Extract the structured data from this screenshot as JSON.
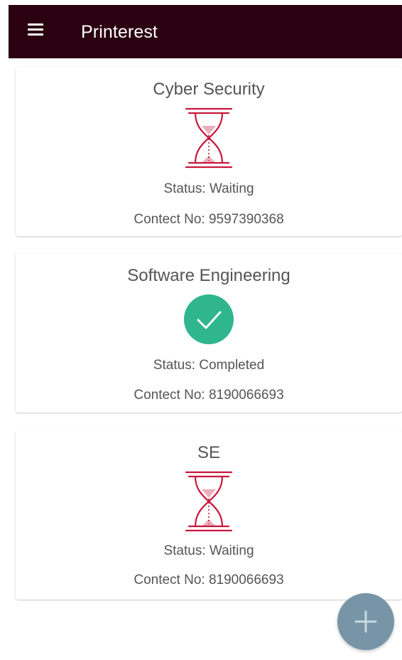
{
  "app": {
    "title": "Printerest",
    "menu_icon": "menu-icon",
    "fab_icon": "plus-icon"
  },
  "colors": {
    "appbar": "#2b0010",
    "waiting": "#c8183c",
    "completed": "#2fb68d",
    "fab": "#7895a7"
  },
  "cards": [
    {
      "title": "Cyber Security",
      "status": "Status: Waiting",
      "contact": "Contect No: 9597390368",
      "icon": "hourglass-icon"
    },
    {
      "title": "Software Engineering",
      "status": "Status: Completed",
      "contact": "Contect No: 8190066693",
      "icon": "check-circle-icon"
    },
    {
      "title": "SE",
      "status": "Status: Waiting",
      "contact": "Contect No: 8190066693",
      "icon": "hourglass-icon"
    }
  ]
}
